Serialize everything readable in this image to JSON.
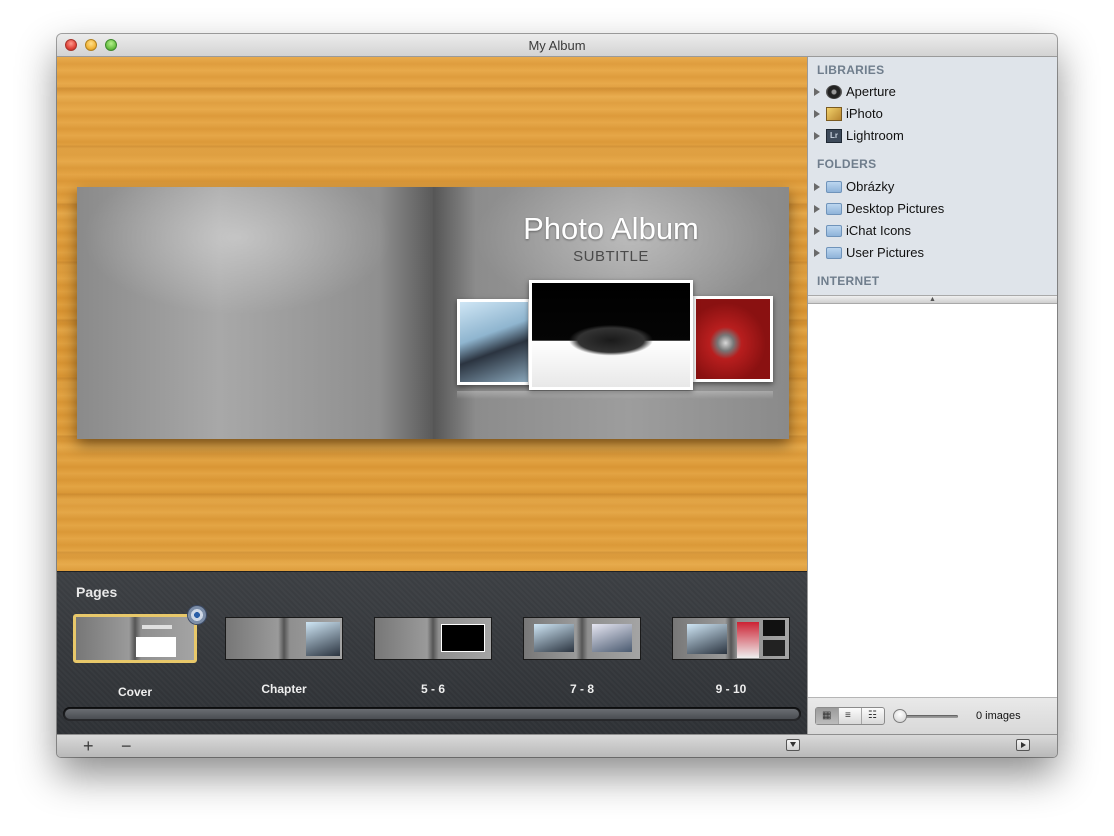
{
  "window": {
    "title": "My Album"
  },
  "album": {
    "title": "Photo Album",
    "subtitle": "SUBTITLE"
  },
  "pages": {
    "label": "Pages",
    "items": [
      {
        "label": "Cover",
        "selected": true
      },
      {
        "label": "Chapter",
        "selected": false
      },
      {
        "label": "5 - 6",
        "selected": false
      },
      {
        "label": "7 - 8",
        "selected": false
      },
      {
        "label": "9 - 10",
        "selected": false
      }
    ]
  },
  "toolbar": {
    "add_symbol": "+",
    "remove_symbol": "−"
  },
  "sidebar": {
    "libraries_header": "LIBRARIES",
    "libraries": [
      {
        "label": "Aperture",
        "icon": "aperture-icon"
      },
      {
        "label": "iPhoto",
        "icon": "iphoto-icon"
      },
      {
        "label": "Lightroom",
        "icon": "lightroom-icon"
      }
    ],
    "folders_header": "FOLDERS",
    "folders": [
      {
        "label": "Obrázky",
        "icon": "folder-icon"
      },
      {
        "label": "Desktop Pictures",
        "icon": "folder-icon"
      },
      {
        "label": "iChat Icons",
        "icon": "folder-icon"
      },
      {
        "label": "User Pictures",
        "icon": "folder-icon"
      }
    ],
    "internet_header": "INTERNET"
  },
  "browser_footer": {
    "image_count": "0 images"
  },
  "colors": {
    "selection_border": "#e8c86a",
    "panel_dark": "#34373b",
    "wood": "#dc9733",
    "sidebar_bg": "#dfe4ea"
  }
}
